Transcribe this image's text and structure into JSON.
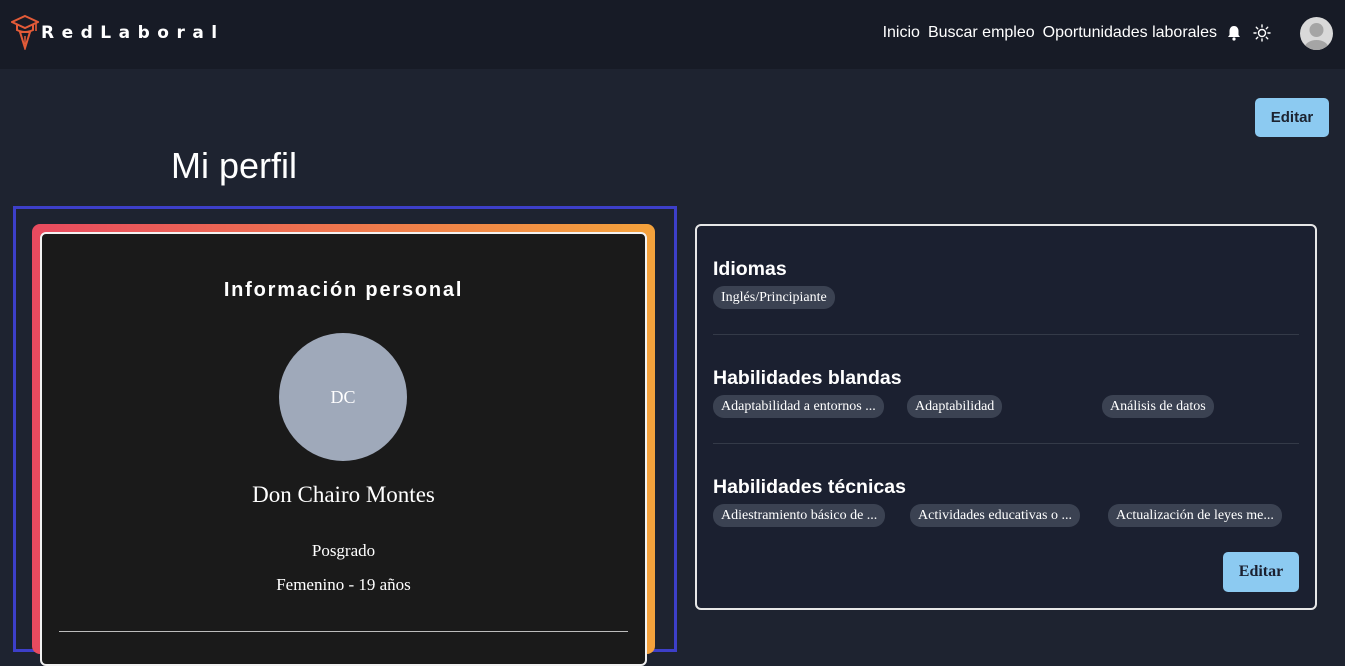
{
  "brand": {
    "name": "RedLaboral"
  },
  "nav": {
    "links": [
      "Inicio",
      "Buscar empleo",
      "Oportunidades laborales"
    ],
    "icons": [
      "bell-icon",
      "sun-icon"
    ]
  },
  "actions": {
    "edit_top": "Editar",
    "edit_bottom": "Editar"
  },
  "page": {
    "title": "Mi perfil"
  },
  "personal": {
    "section_title": "Información personal",
    "initials": "DC",
    "name": "Don Chairo Montes",
    "degree": "Posgrado",
    "info": "Femenino - 19 años"
  },
  "sections": {
    "idiomas": {
      "title": "Idiomas",
      "tags": [
        "Inglés/Principiante"
      ]
    },
    "blandas": {
      "title": "Habilidades blandas",
      "tags": [
        "Adaptabilidad a entornos ...",
        "Adaptabilidad",
        "Análisis de datos"
      ]
    },
    "tecnicas": {
      "title": "Habilidades técnicas",
      "tags": [
        "Adiestramiento básico de ...",
        "Actividades educativas o ...",
        "Actualización de leyes me..."
      ]
    }
  },
  "colors": {
    "background": "#1e2330",
    "navbar": "#171b26",
    "accent_button": "#8ccaf1",
    "frame": "#3d3fc9",
    "gradient_start": "#e84a5f",
    "gradient_end": "#f4a23c",
    "tag": "#3b4252"
  }
}
